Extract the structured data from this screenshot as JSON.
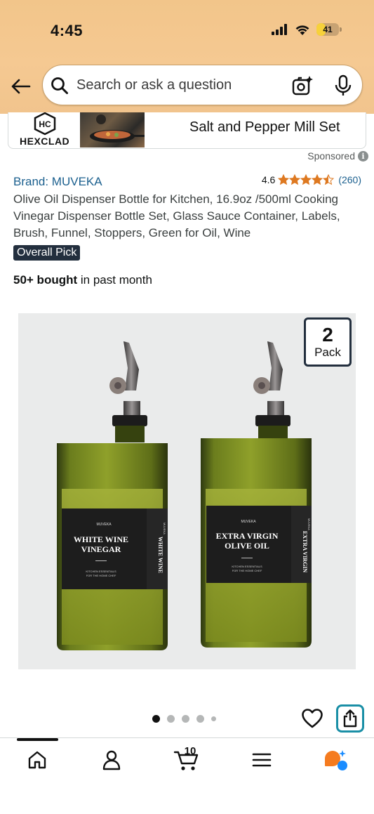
{
  "status_bar": {
    "time": "4:45",
    "battery_level": "41",
    "battery_color": "#f7d13a"
  },
  "header": {
    "back_icon": "arrow-left-icon",
    "search_placeholder": "Search or ask a question",
    "camera_icon": "camera-sparkle-icon",
    "mic_icon": "microphone-icon"
  },
  "banner": {
    "logo_text": "HEXCLAD",
    "title": "Salt and Pepper Mill Set",
    "sponsored_label": "Sponsored",
    "info_icon": "i"
  },
  "product": {
    "brand_label": "Brand: MUVEKA",
    "rating_value": "4.6",
    "stars": 4.5,
    "star_color": "#de7921",
    "review_count": "(260)",
    "title": "Olive Oil Dispenser Bottle for Kitchen, 16.9oz /500ml Cooking Vinegar Dispenser Bottle Set, Glass Sauce Container, Labels, Brush, Funnel, Stoppers, Green for Oil, Wine",
    "badge": "Overall Pick",
    "bought_bold": "50+ bought",
    "bought_rest": " in past month",
    "pack_number": "2",
    "pack_label": "Pack",
    "bottle_labels": {
      "left_brand": "MUVEKA",
      "left_line1": "WHITE WINE",
      "left_line2": "VINEGAR",
      "left_sub1": "KITCHEN ESSENTIALS",
      "left_sub2": "FOR THE HOME CHEF",
      "left_side": "WHITE WINE",
      "left_side_brand": "MUVEKA",
      "right_brand": "MUVEKA",
      "right_line1": "EXTRA VIRGIN",
      "right_line2": "OLIVE OIL",
      "right_sub1": "KITCHEN ESSENTIALS",
      "right_sub2": "FOR THE HOME CHEF",
      "right_side": "EXTRA VIRGIN",
      "right_side_brand": "MUVEKA"
    }
  },
  "carousel": {
    "total_dots": 5,
    "active_index": 0
  },
  "actions": {
    "heart_icon": "heart-outline-icon",
    "share_icon": "share-icon",
    "share_border_color": "#1a8fa6"
  },
  "bottom_nav": {
    "items": [
      {
        "icon": "home-icon"
      },
      {
        "icon": "person-icon"
      },
      {
        "icon": "cart-icon"
      },
      {
        "icon": "menu-icon"
      },
      {
        "icon": "ai-assistant-icon"
      }
    ],
    "cart_count": "10"
  }
}
